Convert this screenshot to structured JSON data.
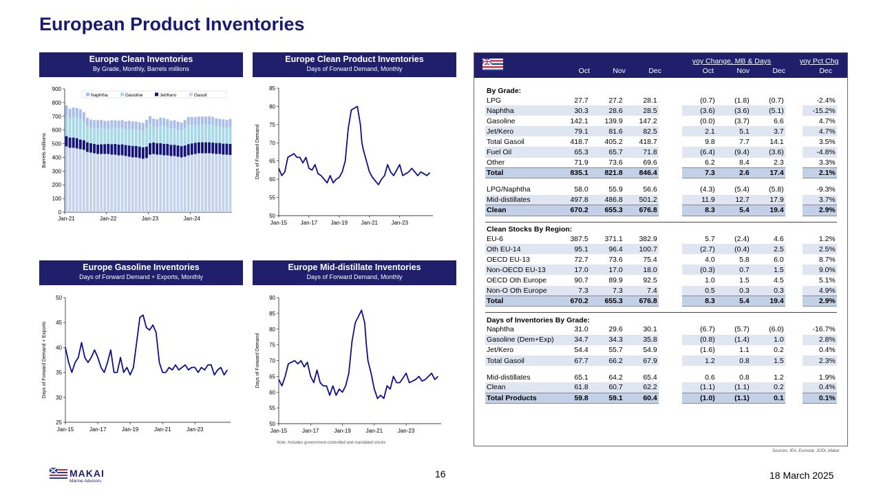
{
  "page": {
    "title": "European Product Inventories",
    "page_number": "16",
    "date": "18 March 2025",
    "note": "Note: Includes government-controlled and mandated stocks",
    "sources": "Sources: IEA, Eurostat, JODI, Makai",
    "logo_word": "MAKAI",
    "logo_sub": "Marine Advisors"
  },
  "colors": {
    "navy": "#1f1f6b",
    "line": "#0d0d8c",
    "naphtha": "#a8bde8",
    "gasoline": "#a6d8e8",
    "jetkero": "#13137a",
    "gasoil": "#c3d3ee"
  },
  "chart_data": [
    {
      "type": "bar",
      "stacked": true,
      "title": "Europe Clean Inventories",
      "subtitle": "By Grade, Monthly, Barrels millions",
      "ylabel": "Barrels millions",
      "ylim": [
        0,
        900
      ],
      "yticks": [
        0,
        100,
        200,
        300,
        400,
        500,
        600,
        700,
        800,
        900
      ],
      "xticks": [
        "Jan-21",
        "Jan-22",
        "Jan-23",
        "Jan-24"
      ],
      "legend": [
        "Naphtha",
        "Gasoline",
        "Jet/Kero",
        "Gasoil"
      ],
      "series": [
        {
          "name": "Gasoil",
          "values": [
            480,
            470,
            470,
            465,
            460,
            455,
            440,
            435,
            430,
            425,
            425,
            425,
            425,
            420,
            420,
            415,
            415,
            410,
            405,
            400,
            400,
            395,
            390,
            395,
            420,
            425,
            420,
            420,
            415,
            415,
            410,
            410,
            405,
            400,
            405,
            415,
            420,
            425,
            430,
            430,
            430,
            430,
            428,
            425,
            425,
            420,
            420,
            418
          ]
        },
        {
          "name": "Jet/Kero",
          "values": [
            75,
            75,
            75,
            75,
            70,
            70,
            70,
            68,
            68,
            68,
            70,
            72,
            74,
            76,
            78,
            78,
            80,
            80,
            82,
            84,
            84,
            84,
            84,
            84,
            84,
            84,
            84,
            84,
            84,
            84,
            82,
            82,
            82,
            82,
            82,
            82,
            82,
            82,
            80,
            80,
            80,
            80,
            80,
            80,
            80,
            80,
            80,
            80
          ]
        },
        {
          "name": "Gasoline",
          "values": [
            150,
            140,
            148,
            150,
            150,
            140,
            120,
            115,
            116,
            120,
            121,
            112,
            110,
            118,
            115,
            117,
            119,
            115,
            122,
            120,
            120,
            118,
            120,
            137,
            140,
            115,
            116,
            128,
            130,
            122,
            118,
            121,
            116,
            115,
            128,
            140,
            135,
            130,
            130,
            130,
            130,
            132,
            130,
            122,
            118,
            120,
            115,
            125
          ]
        },
        {
          "name": "Naphtha",
          "values": [
            75,
            70,
            72,
            70,
            70,
            65,
            60,
            58,
            58,
            58,
            58,
            58,
            58,
            58,
            58,
            58,
            58,
            58,
            58,
            58,
            58,
            58,
            58,
            58,
            58,
            58,
            58,
            58,
            58,
            58,
            58,
            58,
            58,
            58,
            58,
            58,
            58,
            58,
            58,
            58,
            58,
            58,
            58,
            58,
            58,
            58,
            58,
            58
          ]
        }
      ]
    },
    {
      "type": "line",
      "title": "Europe Clean Product Inventories",
      "subtitle": "Days of Forward Demand, Monthly",
      "ylabel": "Days of Forward Demand",
      "ylim": [
        50,
        85
      ],
      "yticks": [
        50,
        55,
        60,
        65,
        70,
        75,
        80,
        85
      ],
      "xlim": [
        2015,
        2025.2
      ],
      "xticks": [
        {
          "v": 2015,
          "label": "Jan-15"
        },
        {
          "v": 2017,
          "label": "Jan-17"
        },
        {
          "v": 2019,
          "label": "Jan-19"
        },
        {
          "v": 2021,
          "label": "Jan-21"
        },
        {
          "v": 2023,
          "label": "Jan-23"
        }
      ],
      "x": [
        2015,
        2015.2,
        2015.4,
        2015.6,
        2015.8,
        2016,
        2016.2,
        2016.4,
        2016.6,
        2016.8,
        2017,
        2017.2,
        2017.4,
        2017.6,
        2017.8,
        2018,
        2018.2,
        2018.4,
        2018.6,
        2018.8,
        2019,
        2019.2,
        2019.4,
        2019.6,
        2019.8,
        2020,
        2020.2,
        2020.4,
        2020.5,
        2020.6,
        2020.8,
        2021,
        2021.2,
        2021.4,
        2021.6,
        2021.8,
        2022,
        2022.2,
        2022.4,
        2022.6,
        2022.8,
        2023,
        2023.2,
        2023.4,
        2023.6,
        2023.8,
        2024,
        2024.2,
        2024.4,
        2024.6,
        2024.8,
        2025
      ],
      "values": [
        63,
        61,
        62,
        66,
        66.5,
        67,
        66,
        66,
        64.5,
        66,
        63,
        62.5,
        64,
        61.5,
        61,
        60,
        59,
        61,
        59,
        60,
        60.5,
        62,
        65,
        74,
        79,
        79.5,
        80,
        75,
        70,
        68,
        65,
        62,
        60.5,
        59.5,
        58.5,
        60,
        61,
        64,
        62,
        61,
        62.5,
        64,
        61,
        61.5,
        62,
        63,
        62,
        61,
        62,
        61.5,
        61,
        61.8
      ]
    },
    {
      "type": "line",
      "title": "Europe Gasoline Inventories",
      "subtitle": "Days of Forward Demand + Exports, Monthly",
      "ylabel": "Days of Forward Demand + Exports",
      "ylim": [
        25,
        50
      ],
      "yticks": [
        25,
        30,
        35,
        40,
        45,
        50
      ],
      "xlim": [
        2015,
        2025.2
      ],
      "xticks": [
        {
          "v": 2015,
          "label": "Jan-15"
        },
        {
          "v": 2017,
          "label": "Jan-17"
        },
        {
          "v": 2019,
          "label": "Jan-19"
        },
        {
          "v": 2021,
          "label": "Jan-21"
        },
        {
          "v": 2023,
          "label": "Jan-23"
        }
      ],
      "x": [
        2015,
        2015.2,
        2015.4,
        2015.6,
        2015.8,
        2016,
        2016.2,
        2016.4,
        2016.6,
        2016.8,
        2017,
        2017.2,
        2017.4,
        2017.6,
        2017.8,
        2018,
        2018.2,
        2018.4,
        2018.6,
        2018.8,
        2019,
        2019.2,
        2019.4,
        2019.6,
        2019.8,
        2020,
        2020.2,
        2020.4,
        2020.6,
        2020.8,
        2021,
        2021.2,
        2021.4,
        2021.6,
        2021.8,
        2022,
        2022.2,
        2022.4,
        2022.6,
        2022.8,
        2023,
        2023.2,
        2023.4,
        2023.6,
        2023.8,
        2024,
        2024.2,
        2024.4,
        2024.6,
        2024.8,
        2025
      ],
      "values": [
        40,
        37,
        35,
        37,
        38,
        41,
        38,
        37,
        38,
        39.5,
        38,
        36,
        35,
        37,
        39.5,
        35,
        35,
        38,
        35,
        36,
        34.5,
        36,
        41,
        46,
        46.5,
        44,
        43.5,
        44.5,
        43,
        37,
        35,
        35,
        36,
        35.5,
        36.5,
        35.5,
        36,
        36.5,
        35.5,
        36,
        36,
        35,
        36,
        35.5,
        36.5,
        36.5,
        34.5,
        35.5,
        36,
        34.5,
        35.5
      ]
    },
    {
      "type": "line",
      "title": "Europe Mid-distillate Inventories",
      "subtitle": "Days of Forward Demand, Monthly",
      "ylabel": "Days of Forward Demand",
      "ylim": [
        50,
        90
      ],
      "yticks": [
        50,
        55,
        60,
        65,
        70,
        75,
        80,
        85,
        90
      ],
      "xlim": [
        2015,
        2025.2
      ],
      "xticks": [
        {
          "v": 2015,
          "label": "Jan-15"
        },
        {
          "v": 2017,
          "label": "Jan-17"
        },
        {
          "v": 2019,
          "label": "Jan-19"
        },
        {
          "v": 2021,
          "label": "Jan-21"
        },
        {
          "v": 2023,
          "label": "Jan-23"
        }
      ],
      "x": [
        2015,
        2015.2,
        2015.4,
        2015.6,
        2015.8,
        2016,
        2016.2,
        2016.4,
        2016.6,
        2016.8,
        2017,
        2017.2,
        2017.4,
        2017.6,
        2017.8,
        2018,
        2018.2,
        2018.4,
        2018.6,
        2018.8,
        2019,
        2019.2,
        2019.4,
        2019.6,
        2019.8,
        2020,
        2020.2,
        2020.4,
        2020.5,
        2020.6,
        2020.8,
        2021,
        2021.2,
        2021.4,
        2021.6,
        2021.8,
        2022,
        2022.2,
        2022.4,
        2022.6,
        2022.8,
        2023,
        2023.2,
        2023.4,
        2023.6,
        2023.8,
        2024,
        2024.2,
        2024.4,
        2024.6,
        2024.8,
        2025
      ],
      "values": [
        64,
        62,
        65,
        69,
        69.5,
        70,
        69,
        70,
        68,
        69.5,
        65,
        63,
        67,
        63,
        62,
        62,
        59,
        62,
        59,
        61,
        60,
        62,
        66,
        76,
        82,
        84,
        86,
        82,
        75,
        70,
        66,
        61,
        58,
        59,
        58,
        62,
        61,
        65,
        63,
        63,
        64.5,
        66,
        63,
        63.5,
        64,
        65,
        63.5,
        64,
        65,
        66,
        64,
        65
      ]
    }
  ],
  "table": {
    "header": {
      "group_yoy": "yoy Change, MB & Days",
      "group_pct": "yoy Pct Chg",
      "cols": [
        "Oct",
        "Nov",
        "Dec",
        "Oct",
        "Nov",
        "Dec",
        "Dec"
      ]
    },
    "sections": [
      {
        "heading": "By Grade:",
        "rows": [
          {
            "label": "LPG",
            "v": [
              "27.7",
              "27.2",
              "28.1",
              "(0.7)",
              "(1.8)",
              "(0.7)",
              "-2.4%"
            ]
          },
          {
            "label": "Naphtha",
            "v": [
              "30.3",
              "28.6",
              "28.5",
              "(3.6)",
              "(3.6)",
              "(5.1)",
              "-15.2%"
            ]
          },
          {
            "label": "Gasoline",
            "v": [
              "142.1",
              "139.9",
              "147.2",
              "(0.0)",
              "(3.7)",
              "6.6",
              "4.7%"
            ]
          },
          {
            "label": "Jet/Kero",
            "v": [
              "79.1",
              "81.6",
              "82.5",
              "2.1",
              "5.1",
              "3.7",
              "4.7%"
            ]
          },
          {
            "label": "Total Gasoil",
            "v": [
              "418.7",
              "405.2",
              "418.7",
              "9.8",
              "7.7",
              "14.1",
              "3.5%"
            ]
          },
          {
            "label": "Fuel Oil",
            "v": [
              "65.3",
              "65.7",
              "71.8",
              "(6.4)",
              "(9.4)",
              "(3.6)",
              "-4.8%"
            ]
          },
          {
            "label": "Other",
            "v": [
              "71.9",
              "73.6",
              "69.6",
              "6.2",
              "8.4",
              "2.3",
              "3.3%"
            ]
          }
        ],
        "total": {
          "label": "Total",
          "v": [
            "835.1",
            "821.8",
            "846.4",
            "7.3",
            "2.6",
            "17.4",
            "2.1%"
          ]
        }
      },
      {
        "heading": "",
        "rows": [
          {
            "label": "LPG/Naphtha",
            "v": [
              "58.0",
              "55.9",
              "56.6",
              "(4.3)",
              "(5.4)",
              "(5.8)",
              "-9.3%"
            ]
          },
          {
            "label": "Mid-distillates",
            "v": [
              "497.8",
              "486.8",
              "501.2",
              "11.9",
              "12.7",
              "17.9",
              "3.7%"
            ]
          }
        ],
        "total": {
          "label": "Clean",
          "v": [
            "670.2",
            "655.3",
            "676.8",
            "8.3",
            "5.4",
            "19.4",
            "2.9%"
          ]
        }
      },
      {
        "heading": "Clean Stocks By Region:",
        "rows": [
          {
            "label": "EU-6",
            "v": [
              "387.5",
              "371.1",
              "382.9",
              "5.7",
              "(2.4)",
              "4.6",
              "1.2%"
            ]
          },
          {
            "label": "Oth EU-14",
            "v": [
              "95.1",
              "96.4",
              "100.7",
              "(2.7)",
              "(0.4)",
              "2.5",
              "2.5%"
            ]
          },
          {
            "label": "OECD EU-13",
            "v": [
              "72.7",
              "73.6",
              "75.4",
              "4.0",
              "5.8",
              "6.0",
              "8.7%"
            ]
          },
          {
            "label": "Non-OECD EU-13",
            "v": [
              "17.0",
              "17.0",
              "18.0",
              "(0.3)",
              "0.7",
              "1.5",
              "9.0%"
            ]
          },
          {
            "label": "OECD Oth Europe",
            "v": [
              "90.7",
              "89.9",
              "92.5",
              "1.0",
              "1.5",
              "4.5",
              "5.1%"
            ]
          },
          {
            "label": "Non-O Oth Europe",
            "v": [
              "7.3",
              "7.3",
              "7.4",
              "0.5",
              "0.3",
              "0.3",
              "4.9%"
            ]
          }
        ],
        "total": {
          "label": "Total",
          "v": [
            "670.2",
            "655.3",
            "676.8",
            "8.3",
            "5.4",
            "19.4",
            "2.9%"
          ]
        }
      },
      {
        "heading": "Days of Inventories By Grade:",
        "rows": [
          {
            "label": "Naphtha",
            "v": [
              "31.0",
              "29.6",
              "30.1",
              "(6.7)",
              "(5.7)",
              "(6.0)",
              "-16.7%"
            ]
          },
          {
            "label": "Gasoline (Dem+Exp)",
            "v": [
              "34.7",
              "34.3",
              "35.8",
              "(0.8)",
              "(1.4)",
              "1.0",
              "2.8%"
            ]
          },
          {
            "label": "Jet/Kero",
            "v": [
              "54.4",
              "55.7",
              "54.9",
              "(1.6)",
              "1.1",
              "0.2",
              "0.4%"
            ]
          },
          {
            "label": "Total Gasoil",
            "v": [
              "67.7",
              "66.2",
              "67.9",
              "1.2",
              "0.8",
              "1.5",
              "2.3%"
            ]
          }
        ]
      },
      {
        "heading": "",
        "rows": [
          {
            "label": "Mid-distillates",
            "v": [
              "65.1",
              "64.2",
              "65.4",
              "0.6",
              "0.8",
              "1.2",
              "1.9%"
            ]
          },
          {
            "label": "Clean",
            "v": [
              "61.8",
              "60.7",
              "62.2",
              "(1.1)",
              "(1.1)",
              "0.2",
              "0.4%"
            ]
          }
        ],
        "total": {
          "label": "Total Products",
          "v": [
            "59.8",
            "59.1",
            "60.4",
            "(1.0)",
            "(1.1)",
            "0.1",
            "0.1%"
          ]
        }
      }
    ]
  }
}
